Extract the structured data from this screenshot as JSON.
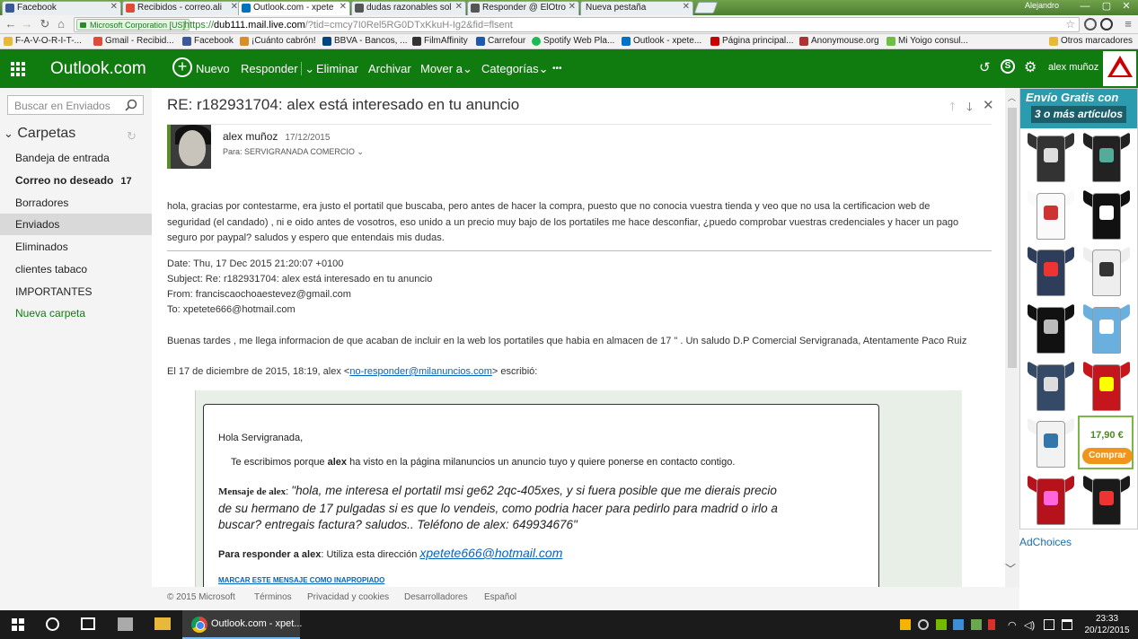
{
  "browser": {
    "tabs": [
      {
        "label": "Facebook",
        "color": "#3b5998"
      },
      {
        "label": "Recibidos - correo.ali",
        "color": "#dd4b39"
      },
      {
        "label": "Outlook.com - xpete",
        "color": "#0072c6"
      },
      {
        "label": "dudas razonables sol",
        "color": "#555555"
      },
      {
        "label": "Responder @ ElOtro",
        "color": "#555555"
      },
      {
        "label": "Nueva pestaña",
        "color": "#cccccc"
      }
    ],
    "window_user": "Alejandro",
    "security_badge": "Microsoft Corporation [US]",
    "url_scheme": "https://",
    "url_host": "dub111.mail.live.com",
    "url_rest": "/?tid=cmcy7I0Rel5RG0DTxKkuH-Ig2&fid=flsent",
    "bookmarks": [
      "F-A-V-O-R-I-T-...",
      "Gmail - Recibid...",
      "Facebook",
      "¡Cuánto cabrón!",
      "BBVA - Bancos, ...",
      "FilmAffinity",
      "Carrefour",
      "Spotify Web Pla...",
      "Outlook - xpete...",
      "Página principal...",
      "Anonymouse.org",
      "Mi Yoigo consul..."
    ],
    "other_bookmarks": "Otros marcadores"
  },
  "outlook": {
    "brand": "Outlook.com",
    "commands": {
      "new": "Nuevo",
      "reply": "Responder",
      "delete": "Eliminar",
      "archive": "Archivar",
      "move": "Mover a",
      "categories": "Categorías",
      "more": "•••"
    },
    "user": "alex muñoz",
    "accent": "#107c10"
  },
  "sidebar": {
    "search_placeholder": "Buscar en Enviados",
    "folders_title": "Carpetas",
    "folders": [
      {
        "label": "Bandeja de entrada",
        "count": ""
      },
      {
        "label": "Correo no deseado",
        "count": "17"
      },
      {
        "label": "Borradores",
        "count": ""
      },
      {
        "label": "Enviados",
        "count": ""
      },
      {
        "label": "Eliminados",
        "count": ""
      },
      {
        "label": "clientes tabaco",
        "count": ""
      },
      {
        "label": "IMPORTANTES",
        "count": ""
      }
    ],
    "new_folder": "Nueva carpeta"
  },
  "message": {
    "subject": "RE: r182931704: alex está interesado en tu anuncio",
    "sender": "alex muñoz",
    "date": "17/12/2015",
    "to": "Para: SERVIGRANADA COMERCIO",
    "body_lines": [
      "hola, gracias por contestarme, era justo el portatil que buscaba, pero antes de hacer la compra, puesto que no conocia vuestra tienda y veo que no usa la certificacion web de",
      "seguridad (el candado) , ni e oido antes de vosotros, eso unido a un precio muy bajo de los portatiles me hace desconfiar, ¿puedo comprobar vuestras credenciales y hacer un pago",
      "seguro por paypal? saludos y espero que entendais mis dudas."
    ],
    "headers": [
      "Date: Thu, 17 Dec 2015 21:20:07 +0100",
      "Subject: Re: r182931704: alex está interesado en tu anuncio",
      "From: franciscaochoaestevez@gmail.com",
      "To: xpetete666@hotmail.com"
    ],
    "reply_text": "Buenas tardes , me llega informacion de que acaban de incluir en la web los portatiles que habia en almacen de 17 \" . Un saludo D.P Comercial Servigranada, Atentamente Paco Ruiz",
    "quote_intro_prefix": "El 17 de diciembre de 2015, 18:19, alex <",
    "quote_intro_email": "no-responder@milanuncios.com",
    "quote_intro_suffix": "> escribió:",
    "quoted": {
      "greeting": "Hola Servigranada,",
      "line_pre": "Te escribimos porque ",
      "line_name": "alex",
      "line_post": " ha visto en la página milanuncios un anuncio tuyo y quiere ponerse en contacto contigo.",
      "msg_label": "Mensaje de alex",
      "msg_lines": [
        "\"hola, me interesa el portatil msi ge62 2qc-405xes, y si fuera posible que me dierais precio",
        "de su hermano de 17 pulgadas si es que lo vendeis, como podria hacer para pedirlo para madrid o irlo a",
        "buscar? entregais factura? saludos.. Teléfono de alex: 649934676\""
      ],
      "reply_label": "Para responder a alex",
      "reply_pre": ": Utiliza esta dirección ",
      "reply_email": "xpetete666@hotmail.com",
      "report_link": "MARCAR ESTE MENSAJE COMO INAPROPIADO"
    }
  },
  "footer": [
    "© 2015 Microsoft",
    "Términos",
    "Privacidad y cookies",
    "Desarrolladores",
    "Español"
  ],
  "ad": {
    "headline1": "Envío Gratis con",
    "headline2": "3 o más artículos",
    "price": "17,90 €",
    "buy": "Comprar",
    "adchoices": "AdChoices"
  },
  "taskbar": {
    "app": "Outlook.com - xpet...",
    "time": "23:33",
    "date": "20/12/2015"
  }
}
